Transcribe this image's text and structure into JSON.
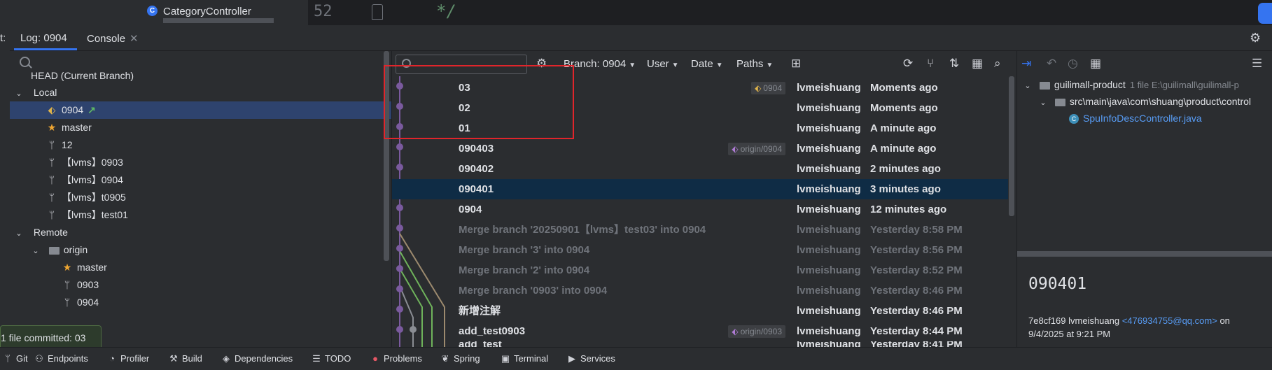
{
  "editor": {
    "class_icon_letter": "C",
    "class_name": "CategoryController",
    "line_number": "52",
    "code_fragment": "*/"
  },
  "tabs": {
    "prefix": "t:",
    "log_label": "Log: 0904",
    "console_label": "Console",
    "close_glyph": "✕"
  },
  "branches": {
    "head": "HEAD (Current Branch)",
    "local_label": "Local",
    "local": [
      {
        "name": "0904",
        "icon": "tag-icon",
        "selected": true
      },
      {
        "name": "master",
        "icon": "star-icon"
      },
      {
        "name": "12",
        "icon": "branch-icon"
      },
      {
        "name": "【lvms】0903",
        "icon": "branch-icon"
      },
      {
        "name": "【lvms】0904",
        "icon": "branch-icon"
      },
      {
        "name": "【lvms】t0905",
        "icon": "branch-icon"
      },
      {
        "name": "【lvms】test01",
        "icon": "branch-icon"
      }
    ],
    "remote_label": "Remote",
    "origin_label": "origin",
    "remote": [
      {
        "name": "master",
        "icon": "star-icon"
      },
      {
        "name": "0903",
        "icon": "branch-icon"
      },
      {
        "name": "0904",
        "icon": "branch-icon"
      }
    ]
  },
  "toast": {
    "text": "1 file committed: 03"
  },
  "log_toolbar": {
    "branch_filter": "Branch: 0904",
    "user_filter": "User",
    "date_filter": "Date",
    "paths_filter": "Paths"
  },
  "commits": [
    {
      "subject": "03",
      "author": "lvmeishuang",
      "date": "Moments ago",
      "ref": "0904",
      "ref_kind": "local"
    },
    {
      "subject": "02",
      "author": "lvmeishuang",
      "date": "Moments ago"
    },
    {
      "subject": "01",
      "author": "lvmeishuang",
      "date": "A minute ago"
    },
    {
      "subject": "090403",
      "author": "lvmeishuang",
      "date": "A minute ago",
      "ref": "origin/0904",
      "ref_kind": "remote"
    },
    {
      "subject": "090402",
      "author": "lvmeishuang",
      "date": "2 minutes ago"
    },
    {
      "subject": "090401",
      "author": "lvmeishuang",
      "date": "3 minutes ago",
      "selected": true
    },
    {
      "subject": "0904",
      "author": "lvmeishuang",
      "date": "12 minutes ago"
    },
    {
      "subject": "Merge branch '20250901【lvms】test03' into 0904",
      "author": "lvmeishuang",
      "date": "Yesterday 8:58 PM",
      "merge": true
    },
    {
      "subject": "Merge branch '3' into 0904",
      "author": "lvmeishuang",
      "date": "Yesterday 8:56 PM",
      "merge": true
    },
    {
      "subject": "Merge branch '2' into 0904",
      "author": "lvmeishuang",
      "date": "Yesterday 8:52 PM",
      "merge": true
    },
    {
      "subject": "Merge branch '0903' into 0904",
      "author": "lvmeishuang",
      "date": "Yesterday 8:46 PM",
      "merge": true
    },
    {
      "subject": "新增注解",
      "author": "lvmeishuang",
      "date": "Yesterday 8:46 PM"
    },
    {
      "subject": "add_test0903",
      "author": "lvmeishuang",
      "date": "Yesterday 8:44 PM",
      "ref": "origin/0903",
      "ref_kind": "remote"
    },
    {
      "subject": "add_test",
      "author": "lvmeishuang",
      "date": "Yesterday 8:41 PM"
    }
  ],
  "details": {
    "module": "guilimall-product",
    "module_meta": "1 file  E:\\guilimall\\guilimall-p",
    "package_path": "src\\main\\java\\com\\shuang\\product\\control",
    "file_name": "SpuInfoDescController.java",
    "file_icon_letter": "C",
    "commit_hash": "090401",
    "commit_info_prefix": "7e8cf169 lvmeishuang",
    "commit_email": "<476934755@qq.com>",
    "commit_info_on": "on",
    "commit_info_date": "9/4/2025 at 9:21 PM"
  },
  "status_bar": {
    "git": "Git",
    "endpoints": "Endpoints",
    "profiler": "Profiler",
    "build": "Build",
    "dependencies": "Dependencies",
    "todo": "TODO",
    "problems": "Problems",
    "spring": "Spring",
    "terminal": "Terminal",
    "services": "Services"
  },
  "colors": {
    "accent": "#3574f0",
    "selection": "#2e436e",
    "highlight_box": "#e0252b",
    "graph_main": "#7a5a9e",
    "graph_green": "#6fb35b",
    "graph_tan": "#9c8a6e"
  }
}
